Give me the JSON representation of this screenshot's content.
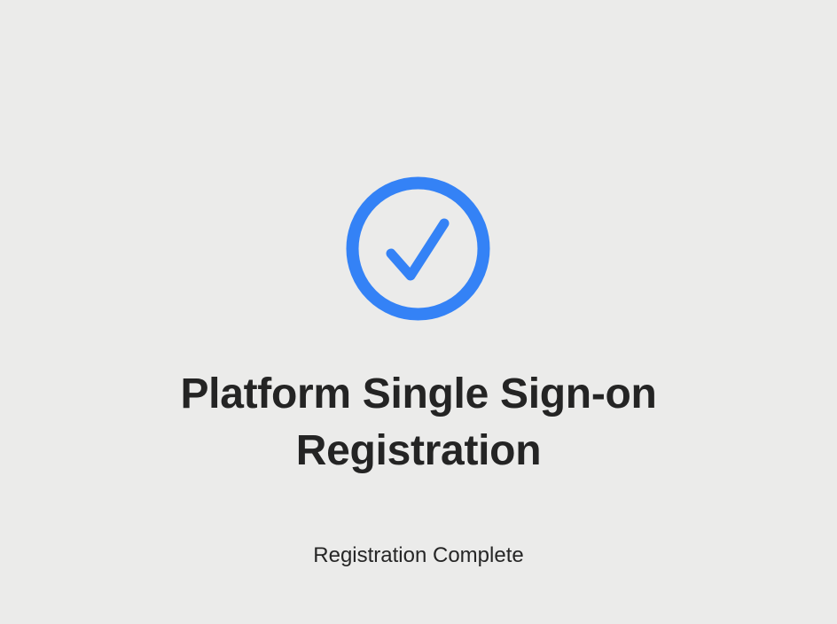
{
  "header": {
    "title_line1": "Platform Single Sign-on",
    "title_line2": "Registration"
  },
  "status": {
    "icon": "checkmark-circle-icon",
    "text": "Registration Complete"
  },
  "colors": {
    "background": "#ebebea",
    "accent": "#3482f6",
    "text": "#242424"
  }
}
